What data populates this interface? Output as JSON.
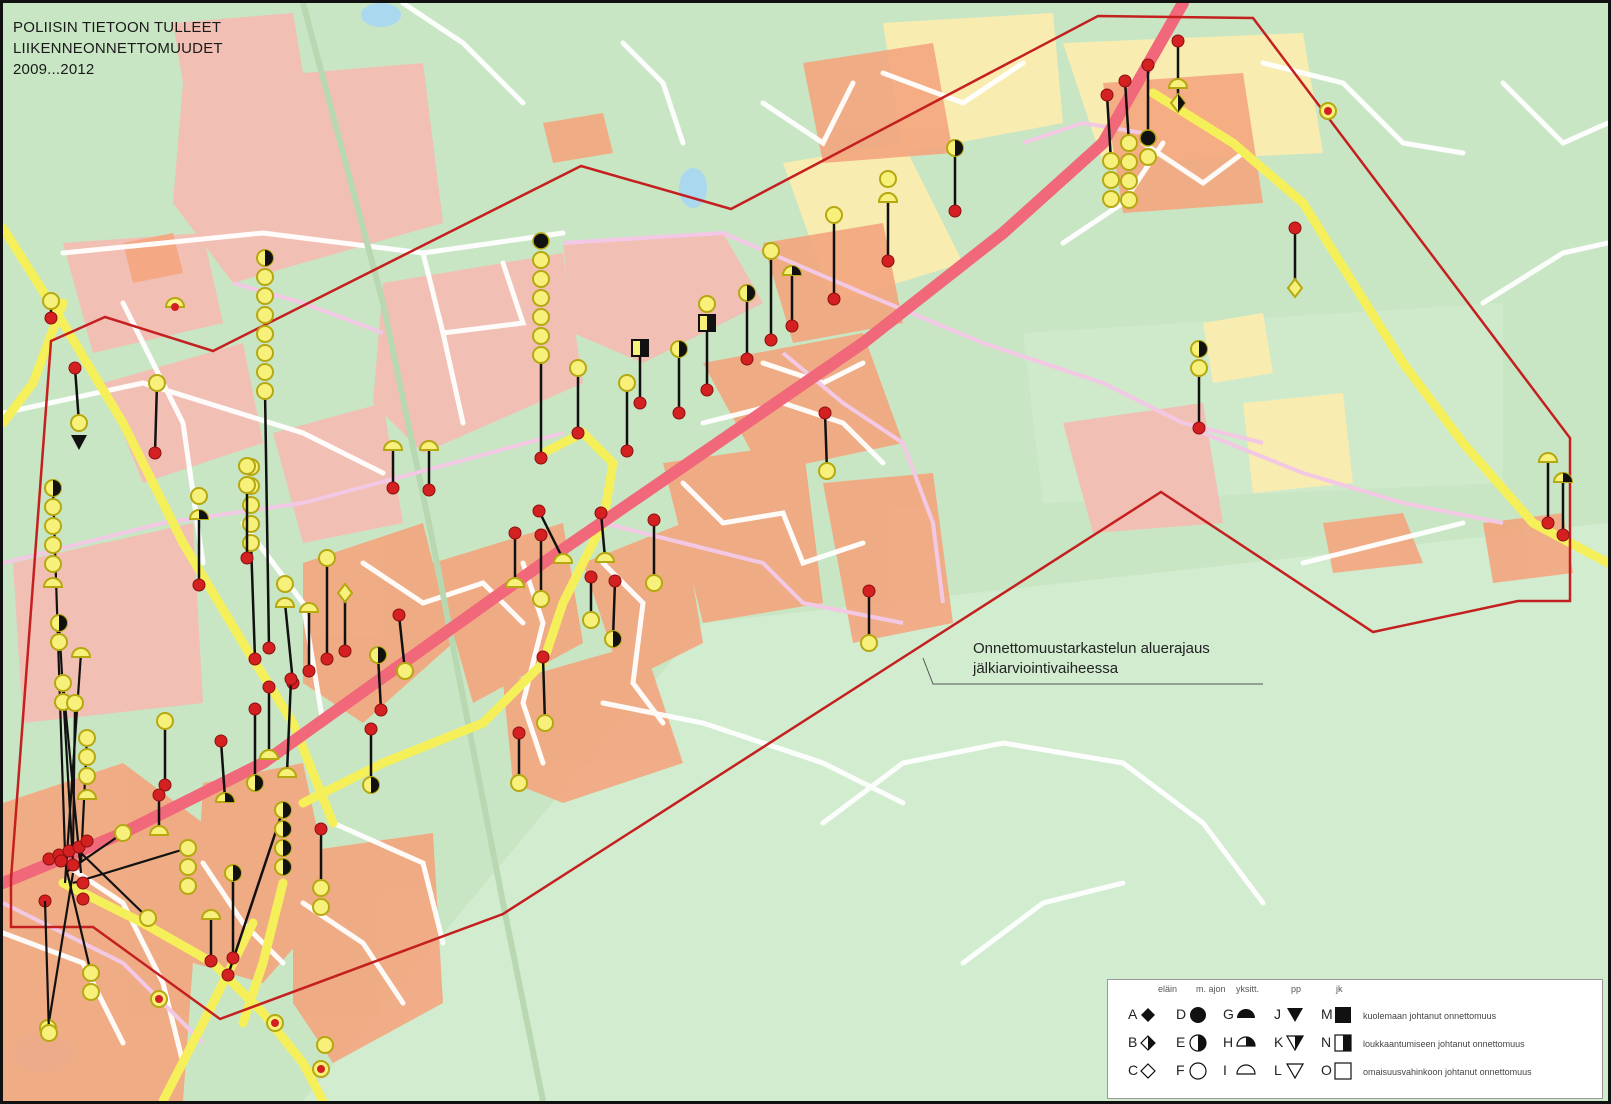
{
  "title": {
    "line1": "POLIISIN TIETOON TULLEET",
    "line2": "LIIKENNEONNETTOMUUDET",
    "line3": "2009...2012"
  },
  "boundary_label": {
    "line1": "Onnettomuustarkastelun aluerajaus",
    "line2": "jälkiarviointivaiheessa"
  },
  "colors": {
    "background_green": "#c8e6c4",
    "residential": "#f4a67e",
    "commercial": "#f2bfb4",
    "main_road": "#f0687a",
    "secondary_road": "#f5f05a",
    "boundary": "#c42020",
    "accident_point": "#d42020",
    "symbol_fill": "#f7f07a",
    "symbol_stroke": "#b5a810"
  },
  "legend": {
    "headers": [
      "eläin",
      "m. ajon",
      "yksitt.",
      "pp",
      "jk"
    ],
    "rows": [
      {
        "letters": [
          "A",
          "D",
          "G",
          "J",
          "M"
        ],
        "fill": "full",
        "description": "kuolemaan johtanut onnettomuus"
      },
      {
        "letters": [
          "B",
          "E",
          "H",
          "K",
          "N"
        ],
        "fill": "half",
        "description": "loukkaantumiseen johtanut onnettomuus"
      },
      {
        "letters": [
          "C",
          "F",
          "I",
          "L",
          "O"
        ],
        "fill": "empty",
        "description": "omaisuusvahinkoon johtanut onnettomuus"
      }
    ]
  }
}
